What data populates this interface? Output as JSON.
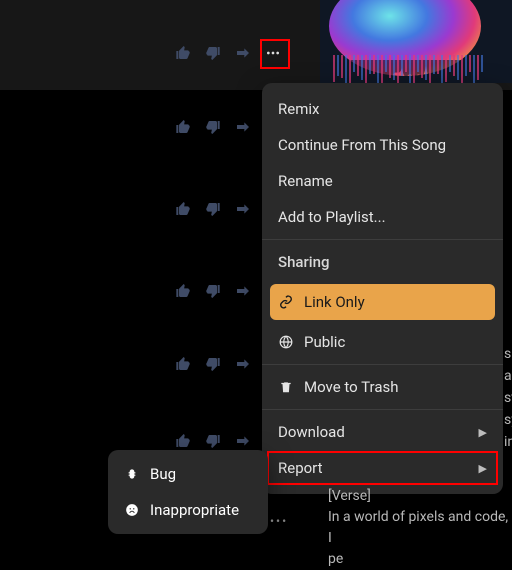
{
  "menu": {
    "remix": "Remix",
    "continue": "Continue From This Song",
    "rename": "Rename",
    "addPlaylist": "Add to Playlist...",
    "sharingHeader": "Sharing",
    "linkOnly": "Link Only",
    "public": "Public",
    "moveTrash": "Move to Trash",
    "download": "Download",
    "report": "Report"
  },
  "reportSubmenu": {
    "bug": "Bug",
    "inappropriate": "Inappropriate"
  },
  "lyrics": {
    "header": "[Verse]",
    "line1": "In a world of pixels and code, I",
    "line2": "pe"
  },
  "sidetext": {
    "l1": "s a",
    "l2": "st",
    "l3": "syr",
    "l4": "int"
  },
  "icons": {
    "more": "more-icon"
  }
}
